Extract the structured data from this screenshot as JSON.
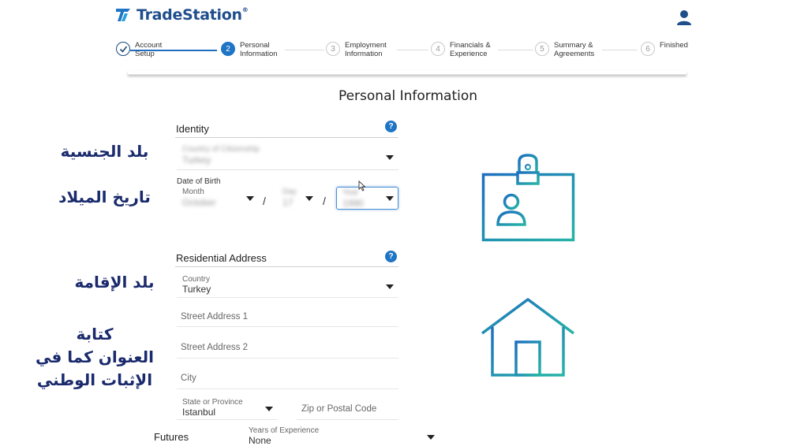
{
  "brand": {
    "name": "TradeStation",
    "registered": "®"
  },
  "steps": [
    {
      "number": "✓",
      "line1": "Account",
      "line2": "Setup",
      "state": "done"
    },
    {
      "number": "2",
      "line1": "Personal",
      "line2": "Information",
      "state": "active"
    },
    {
      "number": "3",
      "line1": "Employment",
      "line2": "Information",
      "state": "pending"
    },
    {
      "number": "4",
      "line1": "Financials &",
      "line2": "Experience",
      "state": "pending"
    },
    {
      "number": "5",
      "line1": "Summary &",
      "line2": "Agreements",
      "state": "pending"
    },
    {
      "number": "6",
      "line1": "Finished",
      "line2": "",
      "state": "pending"
    }
  ],
  "page_title": "Personal Information",
  "identity": {
    "title": "Identity",
    "help": "?",
    "citizenship_label": "Country of Citizenship",
    "citizenship_value": "Turkey",
    "dob_label": "Date of Birth",
    "month_label": "Month",
    "month_value": "October",
    "day_label": "Day",
    "day_value": "17",
    "year_label": "Year",
    "year_value": "1990",
    "separator": "/"
  },
  "address": {
    "title": "Residential Address",
    "help": "?",
    "country_label": "Country",
    "country_value": "Turkey",
    "street1_placeholder": "Street Address 1",
    "street2_placeholder": "Street Address 2",
    "city_placeholder": "City",
    "state_label": "State or Province",
    "state_value": "Istanbul",
    "zip_placeholder": "Zip or Postal Code"
  },
  "futures": {
    "label": "Futures",
    "years_label": "Years of Experience",
    "years_value": "None"
  },
  "annotations": {
    "citizenship": "بلد الجنسية",
    "dob": "تاريخ الميلاد",
    "residence": "بلد الإقامة",
    "address_line1": "كتابة",
    "address_line2": "العنوان كما في",
    "address_line3": "الإثبات الوطني"
  },
  "colors": {
    "brand": "#1f4e8c",
    "accent": "#1e74c5",
    "annotation": "#1a2a6c"
  },
  "icons": [
    "user-icon",
    "id-badge-icon",
    "house-icon",
    "question-icon",
    "chevron-down-icon",
    "check-icon"
  ]
}
